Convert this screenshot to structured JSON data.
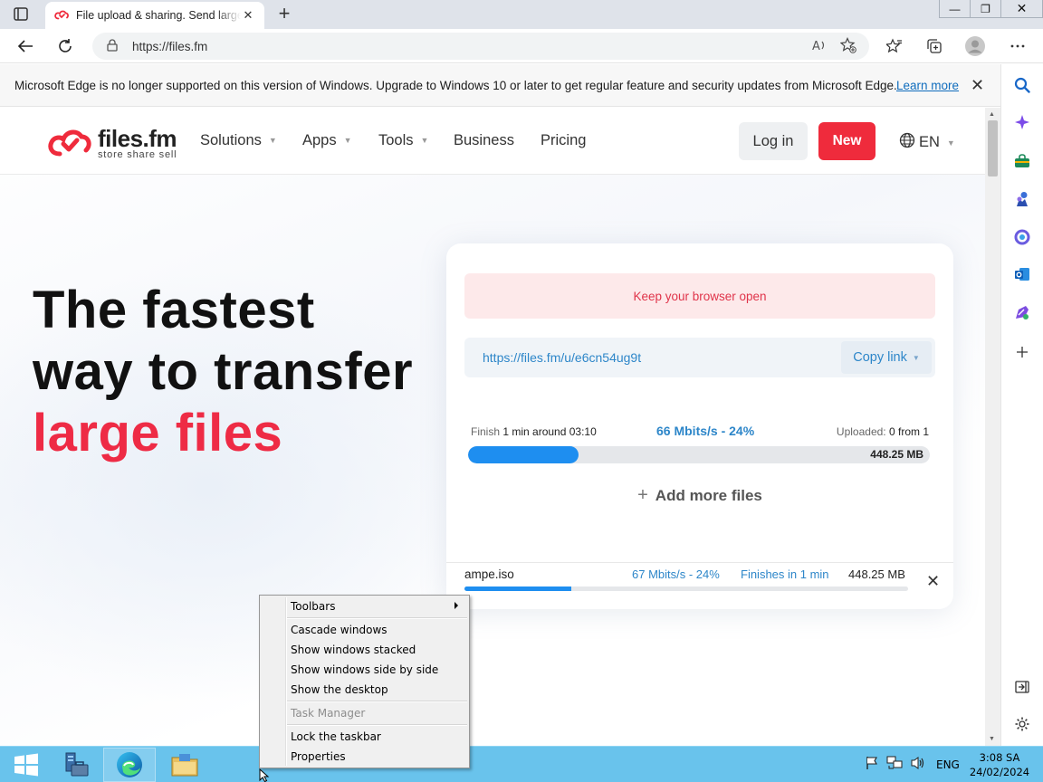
{
  "browser": {
    "tab_title": "File upload & sharing. Send large files",
    "tab_close": "✕",
    "new_tab": "+",
    "url": "https://files.fm",
    "window_buttons": {
      "minimize": "—",
      "restore": "❐",
      "close": "✕"
    }
  },
  "infobar": {
    "message": "Microsoft Edge is no longer supported on this version of Windows. Upgrade to Windows 10 or later to get regular feature and security updates from Microsoft Edge.",
    "learn_more": "Learn more",
    "close": "✕"
  },
  "site": {
    "logo": {
      "main": "files.fm",
      "sub": "store  share  sell"
    },
    "nav": [
      {
        "label": "Solutions",
        "caret": "▼"
      },
      {
        "label": "Apps",
        "caret": "▼"
      },
      {
        "label": "Tools",
        "caret": "▼"
      },
      {
        "label": "Business"
      },
      {
        "label": "Pricing"
      }
    ],
    "login": "Log in",
    "new": "New",
    "lang": "EN",
    "lang_caret": "▼",
    "brand_red": "#ef2b3c",
    "accent_blue": "#1e8ef0"
  },
  "hero": {
    "line1": "The fastest",
    "line2": "way to transfer",
    "line3": "large files"
  },
  "upload": {
    "keep_open": "Keep your browser open",
    "share_url": "https://files.fm/u/e6cn54ug9t",
    "copy_link": "Copy link",
    "copy_caret": "▼",
    "finish_label": "Finish",
    "finish_value": "1 min around 03:10",
    "speed_summary": "66 Mbits/s - 24%",
    "uploaded_label": "Uploaded:",
    "uploaded_value": "0 from 1",
    "total_size": "448.25 MB",
    "progress_fraction": 0.24,
    "add_more": "Add more files",
    "add_more_icon": "+",
    "file": {
      "name": "ampe.iso",
      "speed": "67 Mbits/s - 24%",
      "finishes": "Finishes in 1 min",
      "size": "448.25 MB",
      "progress_fraction": 0.24,
      "remove": "✕"
    }
  },
  "context_menu": {
    "toolbars": "Toolbars",
    "cascade": "Cascade windows",
    "stacked": "Show windows stacked",
    "side_by_side": "Show windows side by side",
    "desktop": "Show the desktop",
    "task_manager": "Task Manager",
    "lock": "Lock the taskbar",
    "properties": "Properties"
  },
  "taskbar": {
    "lang": "ENG",
    "time": "3:08 SA",
    "date": "24/02/2024",
    "color": "#69c3ec"
  }
}
